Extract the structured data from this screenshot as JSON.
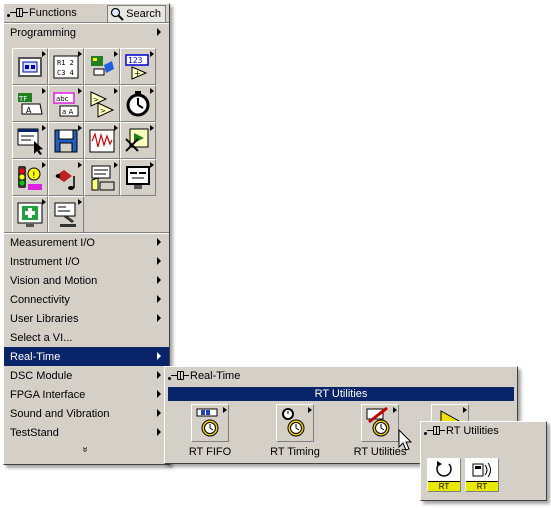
{
  "functions_palette": {
    "title": "Functions",
    "search_label": "Search",
    "programming_label": "Programming",
    "categories": [
      {
        "label": "Measurement I/O"
      },
      {
        "label": "Instrument I/O"
      },
      {
        "label": "Vision and Motion"
      },
      {
        "label": "Connectivity"
      },
      {
        "label": "User Libraries"
      },
      {
        "label": "Select a VI..."
      },
      {
        "label": "Real-Time"
      },
      {
        "label": "DSC Module"
      },
      {
        "label": "FPGA Interface"
      },
      {
        "label": "Sound and Vibration"
      },
      {
        "label": "TestStand"
      }
    ],
    "more_glyph": "»"
  },
  "realtime_palette": {
    "title": "Real-Time",
    "banner": "RT Utilities",
    "items": [
      {
        "label": "RT FIFO"
      },
      {
        "label": "RT Timing"
      },
      {
        "label": "RT Utilities"
      }
    ]
  },
  "rtutilities_palette": {
    "title": "RT Utilities",
    "tile_badges": [
      "RT",
      "RT"
    ]
  },
  "colors": {
    "window_bg": "#d4d0c8",
    "highlight": "#0a246a",
    "highlight_text": "#ffffff",
    "badge_yellow": "#e8e800"
  }
}
